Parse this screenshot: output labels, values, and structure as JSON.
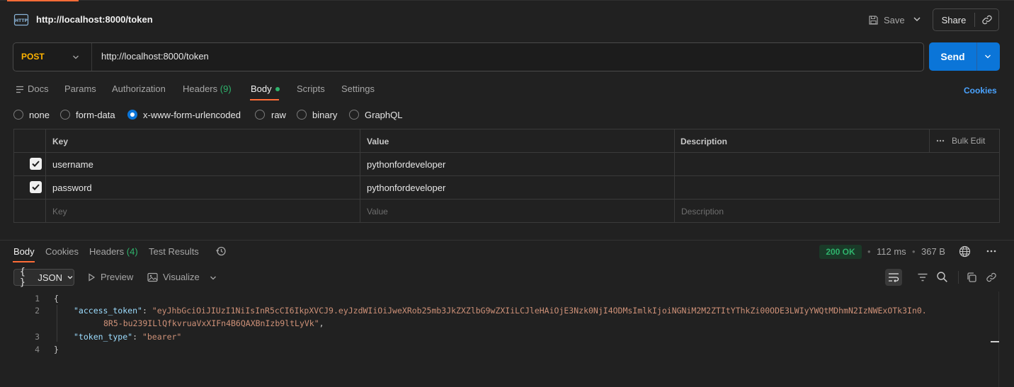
{
  "request": {
    "title": "http://localhost:8000/token",
    "save_label": "Save",
    "share_label": "Share",
    "method": "POST",
    "url": "http://localhost:8000/token",
    "send_label": "Send",
    "tabs": {
      "docs": "Docs",
      "params": "Params",
      "authorization": "Authorization",
      "headers": "Headers",
      "headers_count": "(9)",
      "body": "Body",
      "scripts": "Scripts",
      "settings": "Settings"
    },
    "cookies_label": "Cookies",
    "body_types": [
      "none",
      "form-data",
      "x-www-form-urlencoded",
      "raw",
      "binary",
      "GraphQL"
    ],
    "selected_body_type": "x-www-form-urlencoded",
    "table": {
      "headers": {
        "key": "Key",
        "value": "Value",
        "description": "Description"
      },
      "bulk_edit_label": "Bulk Edit",
      "rows": [
        {
          "checked": true,
          "key": "username",
          "value": "pythonfordeveloper"
        },
        {
          "checked": true,
          "key": "password",
          "value": "pythonfordeveloper"
        }
      ],
      "placeholders": {
        "key": "Key",
        "value": "Value",
        "description": "Description"
      }
    }
  },
  "response": {
    "tabs": {
      "body": "Body",
      "cookies": "Cookies",
      "headers": "Headers",
      "headers_count": "(4)",
      "test_results": "Test Results"
    },
    "status": "200 OK",
    "time": "112 ms",
    "size": "367 B",
    "format": "JSON",
    "preview_label": "Preview",
    "visualize_label": "Visualize",
    "code": {
      "line_numbers": [
        "1",
        "2",
        "3",
        "4"
      ],
      "open_brace": "{",
      "close_brace": "}",
      "access_token_key": "\"access_token\"",
      "access_token_value_1": "\"eyJhbGciOiJIUzI1NiIsInR5cCI6IkpXVCJ9.eyJzdWIiOiJweXRob25mb3JkZXZlbG9wZXIiLCJleHAiOjE3Nzk0NjI4ODMsImlkIjoiNGNiM2M2ZTItYThkZi00ODE3LWIyYWQtMDhmN2IzNWExOTk3In0.",
      "access_token_value_2": "8R5-bu239ILlQfkvruaVxXIFn4B6QAXBnIzb9ltLyVk\"",
      "token_type_key": "\"token_type\"",
      "token_type_value": "\"bearer\""
    }
  },
  "colors": {
    "accent": "#ff6c37",
    "send": "#0b75d8",
    "method": "#ffb400",
    "success": "#2fb36c",
    "link": "#4aa3ff"
  }
}
